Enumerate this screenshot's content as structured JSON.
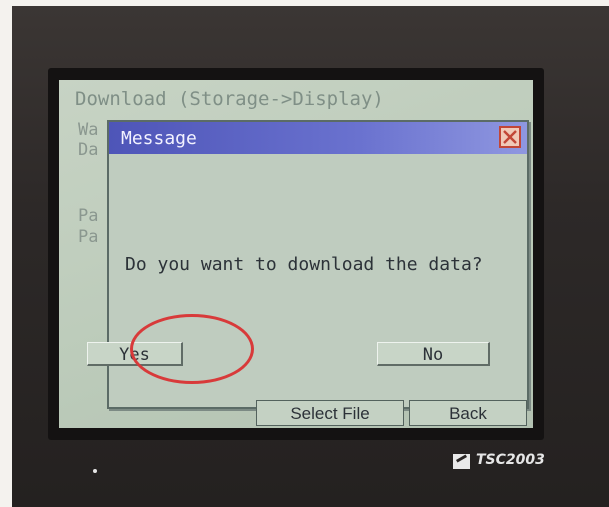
{
  "screen": {
    "background_title": "Download (Storage->Display)",
    "background_fragments": [
      "Wa",
      "Da",
      "Pa",
      "Pa"
    ]
  },
  "dialog": {
    "title": "Message",
    "message": "Do you want to download the data?",
    "yes_label": "Yes",
    "no_label": "No",
    "close_icon": "close-x-icon"
  },
  "softkeys": {
    "select_file_label": "Select File",
    "back_label": "Back"
  },
  "device": {
    "brand": "TSC2003"
  },
  "colors": {
    "titlebar": "#5a62c4",
    "screen_bg": "#c0cdbf",
    "annotation_ring": "#d83a3a",
    "close_button_border": "#c24637"
  }
}
